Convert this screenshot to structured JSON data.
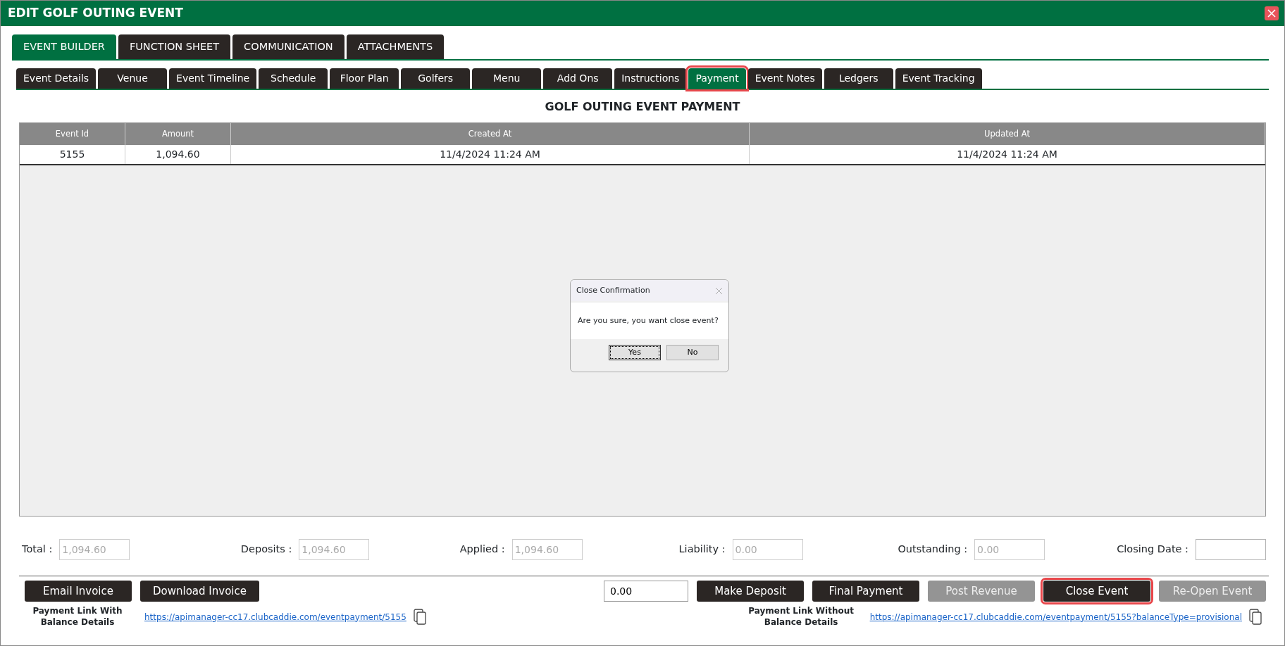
{
  "window": {
    "title": "EDIT GOLF OUTING EVENT"
  },
  "main_tabs": [
    {
      "label": "EVENT BUILDER",
      "selected": true
    },
    {
      "label": "FUNCTION SHEET",
      "selected": false
    },
    {
      "label": "COMMUNICATION",
      "selected": false
    },
    {
      "label": "ATTACHMENTS",
      "selected": false
    }
  ],
  "sub_tabs": [
    {
      "label": "Event Details",
      "selected": false,
      "highlighted": false
    },
    {
      "label": "Venue",
      "selected": false,
      "highlighted": false
    },
    {
      "label": "Event Timeline",
      "selected": false,
      "highlighted": false
    },
    {
      "label": "Schedule",
      "selected": false,
      "highlighted": false
    },
    {
      "label": "Floor Plan",
      "selected": false,
      "highlighted": false
    },
    {
      "label": "Golfers",
      "selected": false,
      "highlighted": false
    },
    {
      "label": "Menu",
      "selected": false,
      "highlighted": false
    },
    {
      "label": "Add Ons",
      "selected": false,
      "highlighted": false
    },
    {
      "label": "Instructions",
      "selected": false,
      "highlighted": false
    },
    {
      "label": "Payment",
      "selected": true,
      "highlighted": true
    },
    {
      "label": "Event Notes",
      "selected": false,
      "highlighted": false
    },
    {
      "label": "Ledgers",
      "selected": false,
      "highlighted": false
    },
    {
      "label": "Event Tracking",
      "selected": false,
      "highlighted": false
    }
  ],
  "heading": "GOLF OUTING EVENT PAYMENT",
  "table": {
    "columns": [
      "Event Id",
      "Amount",
      "Created At",
      "Updated At"
    ],
    "rows": [
      [
        "5155",
        "1,094.60",
        "11/4/2024 11:24 AM",
        "11/4/2024 11:24 AM"
      ]
    ]
  },
  "dialog": {
    "title": "Close Confirmation",
    "message": "Are you sure, you want close event?",
    "buttons": [
      {
        "label": "Yes",
        "focused": true
      },
      {
        "label": "No",
        "focused": false
      }
    ]
  },
  "summary_fields": [
    {
      "label": "Total :",
      "value": "1,094.60",
      "disabled": true
    },
    {
      "label": "Deposits :",
      "value": "1,094.60",
      "disabled": true
    },
    {
      "label": "Applied :",
      "value": "1,094.60",
      "disabled": true
    },
    {
      "label": "Liability :",
      "value": "0.00",
      "disabled": true
    },
    {
      "label": "Outstanding :",
      "value": "0.00",
      "disabled": true
    },
    {
      "label": "Closing Date :",
      "disabled": false
    }
  ],
  "left_buttons": [
    {
      "label": "Email Invoice",
      "disabled": false,
      "highlighted": false
    },
    {
      "label": "Download Invoice",
      "disabled": false,
      "highlighted": false
    }
  ],
  "amount_input": {
    "value": "0.00"
  },
  "right_buttons": [
    {
      "label": "Make Deposit",
      "disabled": false,
      "highlighted": false
    },
    {
      "label": "Final Payment",
      "disabled": false,
      "highlighted": false
    },
    {
      "label": "Post Revenue",
      "disabled": true,
      "highlighted": false
    },
    {
      "label": "Close Event",
      "disabled": false,
      "highlighted": true
    },
    {
      "label": "Re-Open Event",
      "disabled": true,
      "highlighted": false
    }
  ],
  "payment_links": [
    {
      "label": "Payment Link With Balance Details",
      "url": "https://apimanager-cc17.clubcaddie.com/eventpayment/5155"
    },
    {
      "label": "Payment Link Without Balance Details",
      "url": "https://apimanager-cc17.clubcaddie.com/eventpayment/5155?balanceType=provisional"
    }
  ]
}
